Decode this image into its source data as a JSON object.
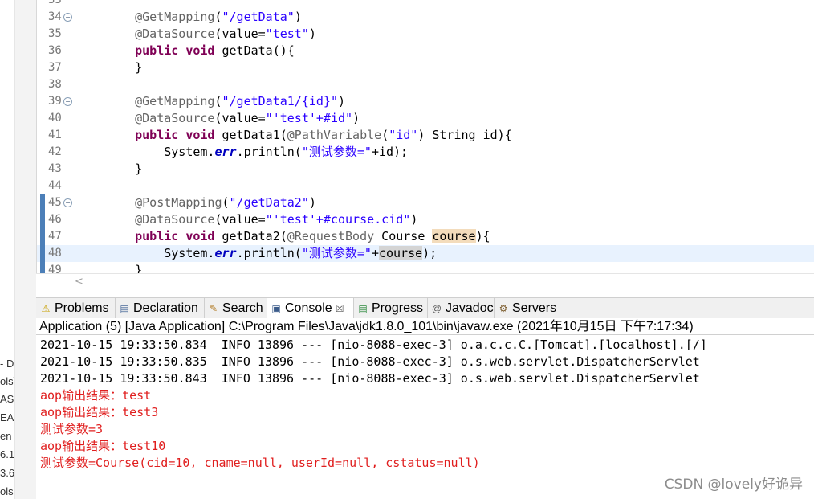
{
  "left_panel": {
    "fragments": [
      "- D",
      "ols\\",
      "AS",
      "EA",
      "en",
      "6.1",
      "3.6",
      "ols"
    ]
  },
  "editor": {
    "lines": [
      {
        "num": "33",
        "tokens": []
      },
      {
        "num": "34",
        "fold": "⊖",
        "tokens": [
          {
            "t": "    "
          },
          {
            "t": "@GetMapping",
            "c": "ann"
          },
          {
            "t": "("
          },
          {
            "t": "\"/getData\"",
            "c": "str"
          },
          {
            "t": ")"
          }
        ]
      },
      {
        "num": "35",
        "tokens": [
          {
            "t": "    "
          },
          {
            "t": "@DataSource",
            "c": "ann"
          },
          {
            "t": "(value="
          },
          {
            "t": "\"test\"",
            "c": "str"
          },
          {
            "t": ")"
          }
        ]
      },
      {
        "num": "36",
        "tokens": [
          {
            "t": "    "
          },
          {
            "t": "public",
            "c": "kw"
          },
          {
            "t": " "
          },
          {
            "t": "void",
            "c": "kw"
          },
          {
            "t": " getData(){"
          }
        ]
      },
      {
        "num": "37",
        "tokens": [
          {
            "t": "    }"
          }
        ]
      },
      {
        "num": "38",
        "tokens": []
      },
      {
        "num": "39",
        "fold": "⊖",
        "tokens": [
          {
            "t": "    "
          },
          {
            "t": "@GetMapping",
            "c": "ann"
          },
          {
            "t": "("
          },
          {
            "t": "\"/getData1/{id}\"",
            "c": "str"
          },
          {
            "t": ")"
          }
        ]
      },
      {
        "num": "40",
        "tokens": [
          {
            "t": "    "
          },
          {
            "t": "@DataSource",
            "c": "ann"
          },
          {
            "t": "(value="
          },
          {
            "t": "\"'test'+#id\"",
            "c": "str"
          },
          {
            "t": ")"
          }
        ]
      },
      {
        "num": "41",
        "tokens": [
          {
            "t": "    "
          },
          {
            "t": "public",
            "c": "kw"
          },
          {
            "t": " "
          },
          {
            "t": "void",
            "c": "kw"
          },
          {
            "t": " getData1("
          },
          {
            "t": "@PathVariable",
            "c": "ann"
          },
          {
            "t": "("
          },
          {
            "t": "\"id\"",
            "c": "str"
          },
          {
            "t": ") String id){"
          }
        ]
      },
      {
        "num": "42",
        "tokens": [
          {
            "t": "        System."
          },
          {
            "t": "err",
            "c": "field"
          },
          {
            "t": ".println("
          },
          {
            "t": "\"测试参数=\"",
            "c": "str"
          },
          {
            "t": "+id);"
          }
        ]
      },
      {
        "num": "43",
        "tokens": [
          {
            "t": "    }"
          }
        ]
      },
      {
        "num": "44",
        "tokens": []
      },
      {
        "num": "45",
        "fold": "⊖",
        "tokens": [
          {
            "t": "    "
          },
          {
            "t": "@PostMapping",
            "c": "ann"
          },
          {
            "t": "("
          },
          {
            "t": "\"/getData2\"",
            "c": "str"
          },
          {
            "t": ")"
          }
        ]
      },
      {
        "num": "46",
        "tokens": [
          {
            "t": "    "
          },
          {
            "t": "@DataSource",
            "c": "ann"
          },
          {
            "t": "(value="
          },
          {
            "t": "\"'test'+#course.cid\"",
            "c": "str"
          },
          {
            "t": ")"
          }
        ]
      },
      {
        "num": "47",
        "tokens": [
          {
            "t": "    "
          },
          {
            "t": "public",
            "c": "kw"
          },
          {
            "t": " "
          },
          {
            "t": "void",
            "c": "kw"
          },
          {
            "t": " getData2("
          },
          {
            "t": "@RequestBody",
            "c": "ann"
          },
          {
            "t": " Course "
          },
          {
            "t": "course",
            "c": "occ"
          },
          {
            "t": "){"
          }
        ]
      },
      {
        "num": "48",
        "current": true,
        "tokens": [
          {
            "t": "        System."
          },
          {
            "t": "err",
            "c": "field"
          },
          {
            "t": ".println("
          },
          {
            "t": "\"测试参数=\"",
            "c": "str"
          },
          {
            "t": "+"
          },
          {
            "t": "course",
            "c": "occ2"
          },
          {
            "t": ");"
          }
        ]
      },
      {
        "num": "49",
        "tokens": [
          {
            "t": "    }"
          }
        ]
      }
    ]
  },
  "views": {
    "tabs": [
      {
        "label": "Problems",
        "icon": "problems-icon",
        "glyph": "⚠",
        "color": "#c8a000"
      },
      {
        "label": "Declaration",
        "icon": "declaration-icon",
        "glyph": "▤",
        "color": "#4a6a9a"
      },
      {
        "label": "Search",
        "icon": "search-icon",
        "glyph": "✎",
        "color": "#b07820"
      },
      {
        "label": "Console",
        "icon": "console-icon",
        "glyph": "▣",
        "color": "#3b5b8a",
        "active": true,
        "closable": true
      },
      {
        "label": "Progress",
        "icon": "progress-icon",
        "glyph": "▤",
        "color": "#2d8a3e"
      },
      {
        "label": "Javadoc",
        "icon": "javadoc-icon",
        "glyph": "@",
        "color": "#555555"
      },
      {
        "label": "Servers",
        "icon": "servers-icon",
        "glyph": "⚙",
        "color": "#7a5a2a"
      }
    ],
    "close_glyph": "☒"
  },
  "console": {
    "title": "Application (5) [Java Application] C:\\Program Files\\Java\\jdk1.8.0_101\\bin\\javaw.exe (2021年10月15日 下午7:17:34)",
    "lines": [
      {
        "text": "2021-10-15 19:33:50.834  INFO 13896 --- [nio-8088-exec-3] o.a.c.c.C.[Tomcat].[localhost].[/]",
        "type": "info"
      },
      {
        "text": "2021-10-15 19:33:50.835  INFO 13896 --- [nio-8088-exec-3] o.s.web.servlet.DispatcherServlet",
        "type": "info"
      },
      {
        "text": "2021-10-15 19:33:50.843  INFO 13896 --- [nio-8088-exec-3] o.s.web.servlet.DispatcherServlet",
        "type": "info"
      },
      {
        "text": "aop输出结果：test",
        "type": "err"
      },
      {
        "text": "aop输出结果：test3",
        "type": "err"
      },
      {
        "text": "测试参数=3",
        "type": "err"
      },
      {
        "text": "aop输出结果：test10",
        "type": "err"
      },
      {
        "text": "测试参数=Course(cid=10, cname=null, userId=null, cstatus=null)",
        "type": "err"
      }
    ]
  },
  "watermark": "CSDN @lovely好诡异",
  "colors": {
    "annotation": "#646464",
    "string": "#2a00ff",
    "keyword": "#7f0055",
    "error_text": "#e01e1e"
  }
}
